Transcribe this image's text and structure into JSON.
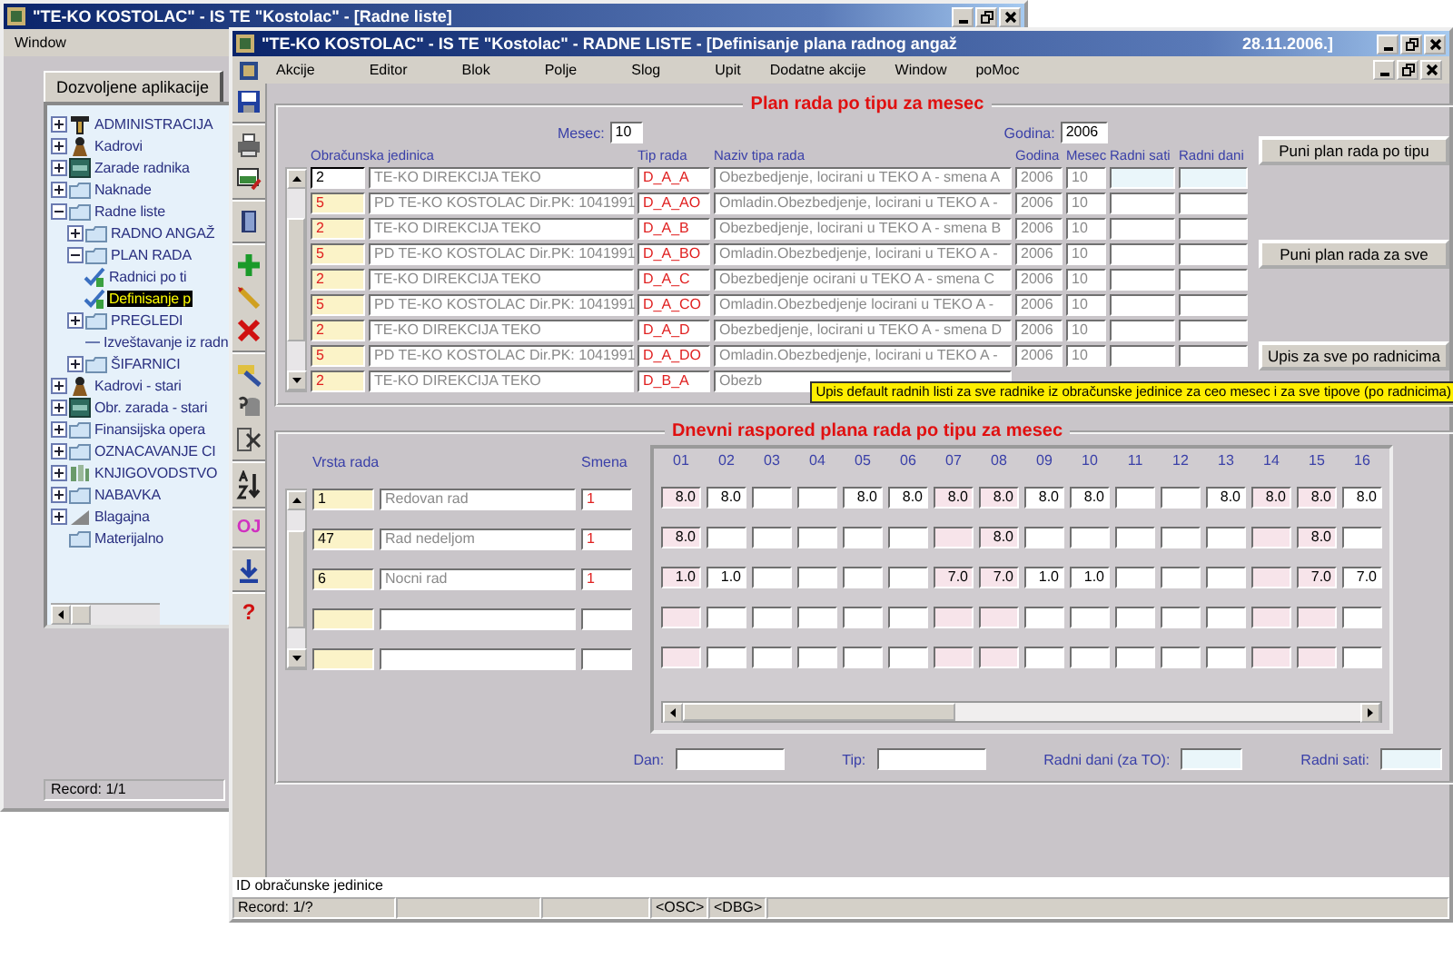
{
  "outer_window": {
    "title": "\"TE-KO KOSTOLAC\" - IS TE \"Kostolac\" - [Radne liste]",
    "menu": [
      "Window"
    ],
    "tab": "Dozvoljene aplikacije",
    "tree": [
      {
        "label": "ADMINISTRACIJA",
        "kind": "admin",
        "expanded": false,
        "selected": false
      },
      {
        "label": "Kadrovi",
        "kind": "person",
        "expanded": false,
        "selected": false
      },
      {
        "label": "Zarade radnika",
        "kind": "money",
        "expanded": false,
        "selected": false
      },
      {
        "label": "Naknade",
        "kind": "folder",
        "expanded": false,
        "selected": false
      },
      {
        "label": "Radne liste",
        "kind": "folder",
        "expanded": true,
        "selected": false,
        "children": [
          {
            "label": "RADNO ANGAŽ",
            "kind": "folder",
            "expanded": false,
            "selected": false
          },
          {
            "label": "PLAN RADA",
            "kind": "folder",
            "expanded": true,
            "selected": false,
            "children": [
              {
                "label": "Radnici po ti",
                "kind": "form",
                "selected": false
              },
              {
                "label": "Definisanje p",
                "kind": "form",
                "selected": true
              }
            ]
          },
          {
            "label": "PREGLEDI",
            "kind": "folder",
            "expanded": false,
            "selected": false
          },
          {
            "label": "Izveštavanje iz radn",
            "kind": "report",
            "selected": false
          },
          {
            "label": "ŠIFARNICI",
            "kind": "folder",
            "expanded": false,
            "selected": false
          }
        ]
      },
      {
        "label": "Kadrovi - stari",
        "kind": "person",
        "expanded": false,
        "selected": false
      },
      {
        "label": "Obr. zarada - stari",
        "kind": "money",
        "expanded": false,
        "selected": false
      },
      {
        "label": "Finansijska opera",
        "kind": "folder",
        "expanded": false,
        "selected": false
      },
      {
        "label": "OZNACAVANJE CI",
        "kind": "folder",
        "expanded": false,
        "selected": false
      },
      {
        "label": "KNJIGOVODSTVO",
        "kind": "books",
        "expanded": false,
        "selected": false
      },
      {
        "label": "NABAVKA",
        "kind": "folder",
        "expanded": false,
        "selected": false
      },
      {
        "label": "Blagajna",
        "kind": "scale",
        "expanded": false,
        "selected": false
      },
      {
        "label": "Materijalno",
        "kind": "folder",
        "selected": false
      }
    ],
    "status": "Record: 1/1"
  },
  "inner_window": {
    "title": "\"TE-KO KOSTOLAC\" - IS TE \"Kostolac\" - RADNE LISTE - [Definisanje plana radnog angaž",
    "date": "28.11.2006.]",
    "menu": [
      "Akcije",
      "Editor",
      "Blok",
      "Polje",
      "Slog",
      "Upit",
      "Dodatne akcije",
      "Window",
      "poMoc"
    ],
    "toolbar": [
      {
        "kind": "save"
      },
      {
        "kind": "separator"
      },
      {
        "kind": "print"
      },
      {
        "kind": "preview"
      },
      {
        "kind": "separator"
      },
      {
        "kind": "exit"
      },
      {
        "kind": "separator"
      },
      {
        "kind": "add"
      },
      {
        "kind": "edit"
      },
      {
        "kind": "delete"
      },
      {
        "kind": "separator"
      },
      {
        "kind": "query"
      },
      {
        "kind": "execute"
      },
      {
        "kind": "cut"
      },
      {
        "kind": "separator"
      },
      {
        "kind": "sort"
      },
      {
        "kind": "separator"
      },
      {
        "kind": "text",
        "label": "OJ"
      },
      {
        "kind": "separator"
      },
      {
        "kind": "download"
      },
      {
        "kind": "separator"
      },
      {
        "kind": "help",
        "label": "?"
      }
    ],
    "top_panel": {
      "title": "Plan rada po tipu za mesec",
      "month_label": "Mesec:",
      "month": "10",
      "year_label": "Godina:",
      "year": "2006",
      "columns": [
        "Obračunska jedinica",
        "Tip rada",
        "Naziv tipa rada",
        "Godina",
        "Mesec",
        "Radni sati",
        "Radni dani"
      ],
      "rows": [
        {
          "selected": true,
          "unit_id": "2",
          "unit": "TE-KO DIREKCIJA TEKO",
          "type": "D_A_A",
          "type_name": "Obezbedjenje, locirani u TEKO A - smena A",
          "year": "2006",
          "month": "10"
        },
        {
          "selected": false,
          "unit_id": "5",
          "unit": "PD TE-KO KOSTOLAC  Dir.PK: 1041991",
          "type": "D_A_AO",
          "type_name": "Omladin.Obezbedjenje, locirani u TEKO A -",
          "year": "2006",
          "month": "10"
        },
        {
          "selected": false,
          "unit_id": "2",
          "unit": "TE-KO DIREKCIJA TEKO",
          "type": "D_A_B",
          "type_name": "Obezbedjenje, locirani u TEKO A - smena B",
          "year": "2006",
          "month": "10"
        },
        {
          "selected": false,
          "unit_id": "5",
          "unit": "PD TE-KO KOSTOLAC  Dir.PK: 1041991",
          "type": "D_A_BO",
          "type_name": "Omladin.Obezbedjenje, locirani u TEKO A -",
          "year": "2006",
          "month": "10"
        },
        {
          "selected": false,
          "unit_id": "2",
          "unit": "TE-KO DIREKCIJA TEKO",
          "type": "D_A_C",
          "type_name": "Obezbedjenje  ocirani u TEKO A - smena C",
          "year": "2006",
          "month": "10"
        },
        {
          "selected": false,
          "unit_id": "5",
          "unit": "PD TE-KO KOSTOLAC  Dir.PK: 1041991",
          "type": "D_A_CO",
          "type_name": "Omladin.Obezbedjenje locirani u TEKO A -",
          "year": "2006",
          "month": "10"
        },
        {
          "selected": false,
          "unit_id": "2",
          "unit": "TE-KO DIREKCIJA TEKO",
          "type": "D_A_D",
          "type_name": "Obezbedjenje, locirani u TEKO A - smena D",
          "year": "2006",
          "month": "10"
        },
        {
          "selected": false,
          "unit_id": "5",
          "unit": "PD TE-KO KOSTOLAC  Dir.PK: 1041991",
          "type": "D_A_DO",
          "type_name": "Omladin.Obezbedjenje, locirani u TEKO A -",
          "year": "2006",
          "month": "10"
        },
        {
          "selected": false,
          "unit_id": "2",
          "unit": "TE-KO DIREKCIJA TEKO",
          "type": "D_B_A",
          "type_name": "Obezb"
        }
      ],
      "buttons": [
        "Puni plan rada po tipu",
        "Puni plan rada za sve",
        "Upis za sve po radnicima"
      ],
      "tooltip": "Upis default radnih listi za sve radnike iz obračunske jedinice za ceo mesec i za sve tipove (po radnicima)"
    },
    "bottom_panel": {
      "title": "Dnevni raspored plana rada po tipu za mesec",
      "columns": [
        "Vrsta rada",
        "Smena"
      ],
      "days": [
        {
          "label": "01",
          "weekend": true
        },
        {
          "label": "02",
          "weekend": false
        },
        {
          "label": "03",
          "weekend": false
        },
        {
          "label": "04",
          "weekend": false
        },
        {
          "label": "05",
          "weekend": false
        },
        {
          "label": "06",
          "weekend": false
        },
        {
          "label": "07",
          "weekend": true
        },
        {
          "label": "08",
          "weekend": true
        },
        {
          "label": "09",
          "weekend": false
        },
        {
          "label": "10",
          "weekend": false
        },
        {
          "label": "11",
          "weekend": false
        },
        {
          "label": "12",
          "weekend": false
        },
        {
          "label": "13",
          "weekend": false
        },
        {
          "label": "14",
          "weekend": true
        },
        {
          "label": "15",
          "weekend": true
        },
        {
          "label": "16",
          "weekend": false
        }
      ],
      "rows": [
        {
          "code": "1",
          "name": "Redovan rad",
          "shift": "1",
          "hours": [
            {
              "kind": "hours",
              "value": "8.0"
            },
            {
              "kind": "hours",
              "value": "8.0"
            },
            {
              "kind": "blank"
            },
            {
              "kind": "blank"
            },
            {
              "kind": "hours",
              "value": "8.0"
            },
            {
              "kind": "hours",
              "value": "8.0"
            },
            {
              "kind": "hours",
              "value": "8.0"
            },
            {
              "kind": "hours",
              "value": "8.0"
            },
            {
              "kind": "hours",
              "value": "8.0"
            },
            {
              "kind": "hours",
              "value": "8.0"
            },
            {
              "kind": "blank"
            },
            {
              "kind": "blank"
            },
            {
              "kind": "hours",
              "value": "8.0"
            },
            {
              "kind": "hours",
              "value": "8.0"
            },
            {
              "kind": "hours",
              "value": "8.0"
            },
            {
              "kind": "hours",
              "value": "8.0"
            }
          ]
        },
        {
          "code": "47",
          "name": "Rad nedeljom",
          "shift": "1",
          "hours": [
            {
              "kind": "hours",
              "value": "8.0"
            },
            {
              "kind": "blank"
            },
            {
              "kind": "blank"
            },
            {
              "kind": "blank"
            },
            {
              "kind": "blank"
            },
            {
              "kind": "blank"
            },
            {
              "kind": "blank"
            },
            {
              "kind": "hours",
              "value": "8.0"
            },
            {
              "kind": "blank"
            },
            {
              "kind": "blank"
            },
            {
              "kind": "blank"
            },
            {
              "kind": "blank"
            },
            {
              "kind": "blank"
            },
            {
              "kind": "blank"
            },
            {
              "kind": "hours",
              "value": "8.0"
            },
            {
              "kind": "blank"
            }
          ]
        },
        {
          "code": "6",
          "name": "Nocni rad",
          "shift": "1",
          "hours": [
            {
              "kind": "hours",
              "value": "1.0"
            },
            {
              "kind": "hours",
              "value": "1.0"
            },
            {
              "kind": "blank"
            },
            {
              "kind": "blank"
            },
            {
              "kind": "blank"
            },
            {
              "kind": "blank"
            },
            {
              "kind": "hours",
              "value": "7.0"
            },
            {
              "kind": "hours",
              "value": "7.0"
            },
            {
              "kind": "hours",
              "value": "1.0"
            },
            {
              "kind": "hours",
              "value": "1.0"
            },
            {
              "kind": "blank"
            },
            {
              "kind": "blank"
            },
            {
              "kind": "blank"
            },
            {
              "kind": "blank"
            },
            {
              "kind": "hours",
              "value": "7.0"
            },
            {
              "kind": "hours",
              "value": "7.0"
            }
          ]
        },
        {
          "hours": [
            {
              "kind": "blank"
            },
            {
              "kind": "blank"
            },
            {
              "kind": "blank"
            },
            {
              "kind": "blank"
            },
            {
              "kind": "blank"
            },
            {
              "kind": "blank"
            },
            {
              "kind": "blank"
            },
            {
              "kind": "blank"
            },
            {
              "kind": "blank"
            },
            {
              "kind": "blank"
            },
            {
              "kind": "blank"
            },
            {
              "kind": "blank"
            },
            {
              "kind": "blank"
            },
            {
              "kind": "blank"
            },
            {
              "kind": "blank"
            },
            {
              "kind": "blank"
            }
          ]
        },
        {
          "hours": [
            {
              "kind": "blank"
            },
            {
              "kind": "blank"
            },
            {
              "kind": "blank"
            },
            {
              "kind": "blank"
            },
            {
              "kind": "blank"
            },
            {
              "kind": "blank"
            },
            {
              "kind": "blank"
            },
            {
              "kind": "blank"
            },
            {
              "kind": "blank"
            },
            {
              "kind": "blank"
            },
            {
              "kind": "blank"
            },
            {
              "kind": "blank"
            },
            {
              "kind": "blank"
            },
            {
              "kind": "blank"
            },
            {
              "kind": "blank"
            },
            {
              "kind": "blank"
            }
          ]
        }
      ],
      "fields": [
        {
          "label": "Dan:",
          "kind": "plain"
        },
        {
          "label": "Tip:",
          "kind": "plain"
        },
        {
          "label": "Radni dani (za TO):",
          "kind": "readonly"
        },
        {
          "label": "Radni sati:",
          "kind": "readonly"
        }
      ]
    },
    "hint": "ID obračunske jedinice",
    "status": [
      "Record: 1/?",
      "<OSC>",
      "<DBG>"
    ]
  }
}
